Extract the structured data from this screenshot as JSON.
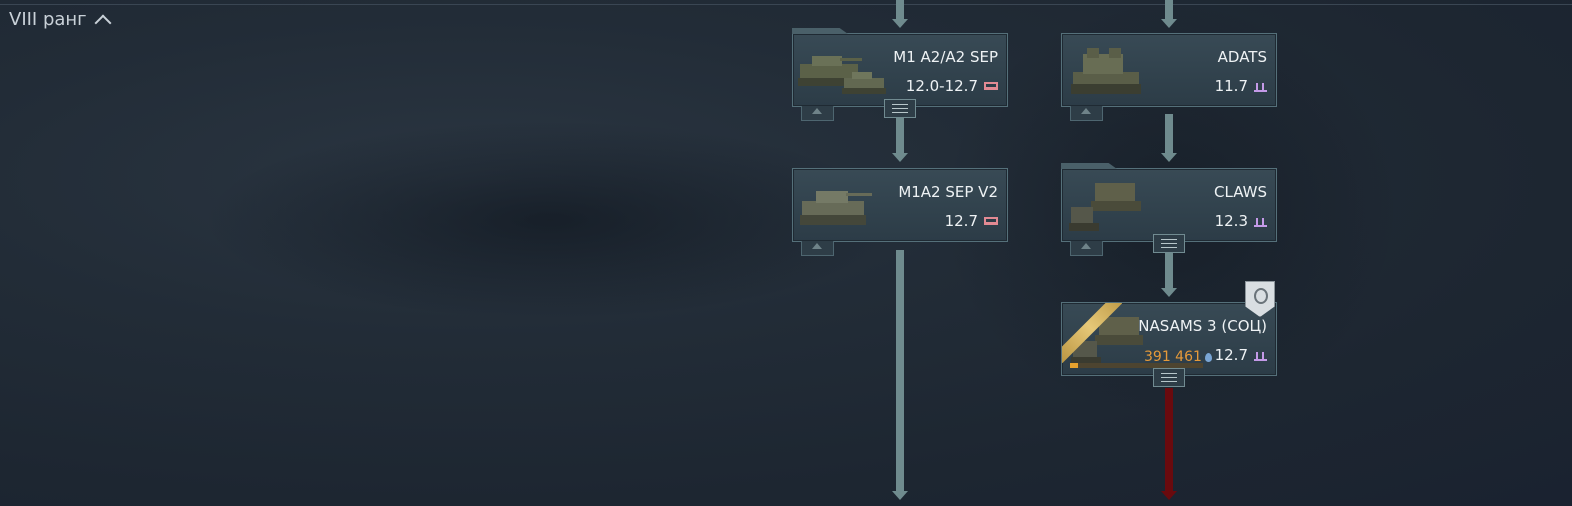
{
  "rank": {
    "label": "VIII ранг"
  },
  "vehicles": [
    {
      "name": "M1 A2/A2 SEP",
      "br": "12.0-12.7",
      "type": "tank"
    },
    {
      "name": "ADATS",
      "br": "11.7",
      "type": "aa"
    },
    {
      "name": "M1A2 SEP V2",
      "br": "12.7",
      "type": "tank"
    },
    {
      "name": "CLAWS",
      "br": "12.3",
      "type": "aa"
    },
    {
      "name": "NASAMS 3 (СОЦ)",
      "br": "12.7",
      "type": "aa",
      "research_points": "391 461",
      "research_progress": 0.06
    }
  ],
  "colors": {
    "tank_icon": "#e28a93",
    "aa_icon": "#c49ae8",
    "research": "#e59a3a",
    "link": "#6f8b8e",
    "locked_link": "#6a0a0e"
  }
}
